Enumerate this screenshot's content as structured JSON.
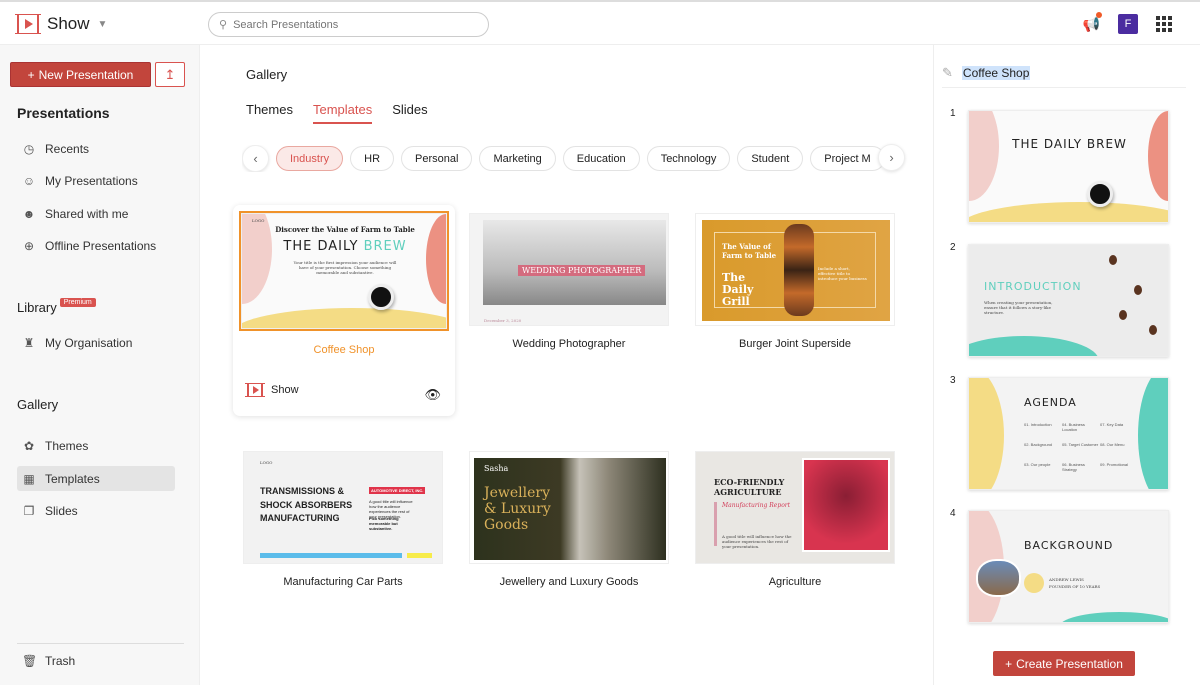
{
  "header": {
    "app_name": "Show",
    "search_placeholder": "Search Presentations",
    "avatar_initial": "F",
    "icons": [
      "show-logo-icon",
      "search-icon",
      "announcement-icon",
      "apps-grid-icon"
    ]
  },
  "sidebar": {
    "new_presentation": "New Presentation",
    "presentations_heading": "Presentations",
    "presentations": [
      {
        "label": "Recents",
        "icon": "clock-icon"
      },
      {
        "label": "My Presentations",
        "icon": "user-circle-icon"
      },
      {
        "label": "Shared with me",
        "icon": "shared-users-icon"
      },
      {
        "label": "Offline Presentations",
        "icon": "offline-icon"
      }
    ],
    "library_heading": "Library",
    "premium_badge": "Premium",
    "library": [
      {
        "label": "My Organisation",
        "icon": "organisation-icon"
      }
    ],
    "gallery_heading": "Gallery",
    "gallery": [
      {
        "label": "Themes",
        "icon": "palette-icon"
      },
      {
        "label": "Templates",
        "icon": "templates-icon",
        "active": true
      },
      {
        "label": "Slides",
        "icon": "slides-icon"
      }
    ],
    "trash": "Trash"
  },
  "main": {
    "title": "Gallery",
    "tabs": [
      {
        "label": "Themes"
      },
      {
        "label": "Templates",
        "active": true
      },
      {
        "label": "Slides"
      }
    ],
    "chips": [
      "Industry",
      "HR",
      "Personal",
      "Marketing",
      "Education",
      "Technology",
      "Student",
      "Project M"
    ],
    "active_chip": "Industry",
    "templates": [
      {
        "name": "Coffee Shop",
        "selected": true,
        "brand": "Show",
        "thumb": {
          "logo": "LOGO",
          "kicker": "Discover the Value of Farm to Table",
          "title1": "THE DAILY",
          "title2": "BREW",
          "body": "Your title is the first impression your audience will have of your presentation. Choose something memorable and substantive."
        }
      },
      {
        "name": "Wedding Photographer",
        "thumb": {
          "title": "WEDDING PHOTOGRAPHER",
          "date": "December 3, 2020"
        }
      },
      {
        "name": "Burger Joint Superside",
        "thumb": {
          "kicker": "The Value of Farm to Table",
          "title": "The Daily Grill",
          "body": "Include a short, effective title to introduce your business"
        }
      },
      {
        "name": "Manufacturing Car Parts",
        "thumb": {
          "logo": "LOGO",
          "title": "TRANSMISSIONS & SHOCK ABSORBERS MANUFACTURING",
          "tag": "AUTOMOTIVE DIRECT, INC.",
          "body": "A good title will influence how the audience experiences the rest of your presentation.",
          "bold": "Pick something memorable but substantive."
        }
      },
      {
        "name": "Jewellery and Luxury Goods",
        "thumb": {
          "brand": "Sasha",
          "title": "Jewellery & Luxury Goods"
        }
      },
      {
        "name": "Agriculture",
        "thumb": {
          "title": "ECO-FRIENDLY AGRICULTURE",
          "subtitle": "Manufacturing Report",
          "body": "A good title will influence how the audience experiences the rest of your presentation."
        }
      }
    ]
  },
  "panel": {
    "title": "Coffee Shop",
    "slides": [
      {
        "number": "1",
        "title": "THE DAILY BREW"
      },
      {
        "number": "2",
        "title": "INTRODUCTION",
        "body": "When creating your presentation, ensure that it follows a story-like structure."
      },
      {
        "number": "3",
        "title": "AGENDA",
        "items": [
          "01. Introduction",
          "02. Background",
          "03. Our people",
          "04. Business Location",
          "05. Target Customer",
          "06. Business Strategy",
          "07. Key Data",
          "08. Our Menu",
          "09. Promotional"
        ]
      },
      {
        "number": "4",
        "title": "BACKGROUND",
        "person": "ANDREW LEWIS",
        "role": "FOUNDER OF 10 YEARS"
      }
    ],
    "create_button": "Create Presentation"
  },
  "colors": {
    "accent": "#c2453c",
    "selected": "#f0922a",
    "teal": "#5fcfbd",
    "yellow": "#f4dc85",
    "pink": "#f2cfcb"
  }
}
